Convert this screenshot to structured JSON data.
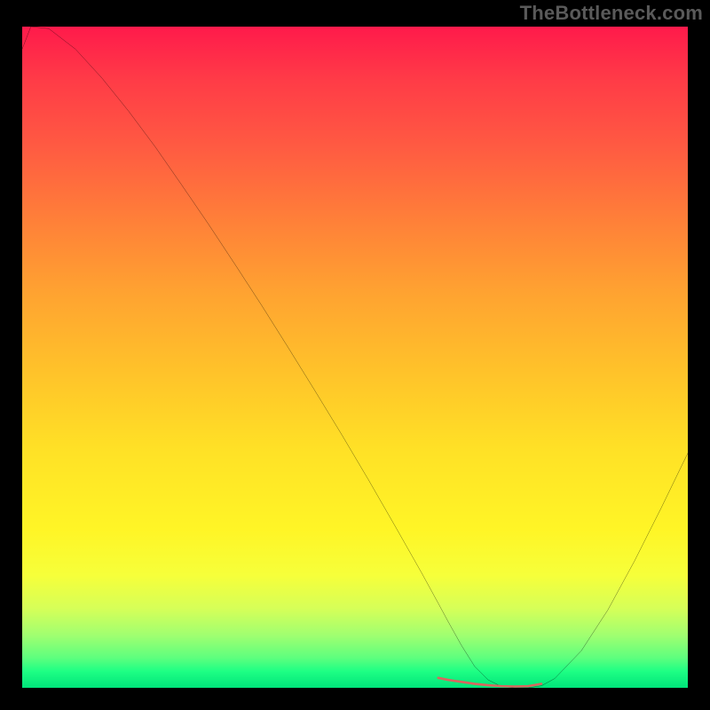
{
  "attribution": "TheBottleneck.com",
  "chart_data": {
    "type": "line",
    "title": "",
    "xlabel": "",
    "ylabel": "",
    "xlim": [
      0,
      100
    ],
    "ylim": [
      0,
      100
    ],
    "series": [
      {
        "name": "bottleneck-curve",
        "x": [
          0,
          1.3,
          4,
          8,
          12,
          16,
          20,
          24,
          28,
          32,
          36,
          40,
          44,
          48,
          52,
          56,
          60,
          62.5,
          64,
          66,
          68,
          70,
          72,
          74,
          76,
          78,
          80,
          84,
          88,
          92,
          96,
          100
        ],
        "y": [
          96.6,
          100,
          99.7,
          96.6,
          92.2,
          87.2,
          81.8,
          76,
          70.1,
          64,
          57.8,
          51.4,
          44.9,
          38.3,
          31.5,
          24.5,
          17.4,
          12.8,
          10,
          6.4,
          3.2,
          1.2,
          0.2,
          0,
          0,
          0.3,
          1.4,
          5.6,
          11.8,
          19.2,
          27.2,
          35.5
        ]
      },
      {
        "name": "optimal-marker",
        "x": [
          62.5,
          64,
          66,
          68,
          70,
          72,
          74,
          76,
          78
        ],
        "y": [
          1.5,
          1.2,
          0.9,
          0.6,
          0.4,
          0.25,
          0.2,
          0.25,
          0.6
        ]
      }
    ],
    "gradient_stops": [
      {
        "pos": 0,
        "color": "#ff1a4b"
      },
      {
        "pos": 50,
        "color": "#ffc22a"
      },
      {
        "pos": 80,
        "color": "#fff526"
      },
      {
        "pos": 100,
        "color": "#00e47a"
      }
    ]
  }
}
